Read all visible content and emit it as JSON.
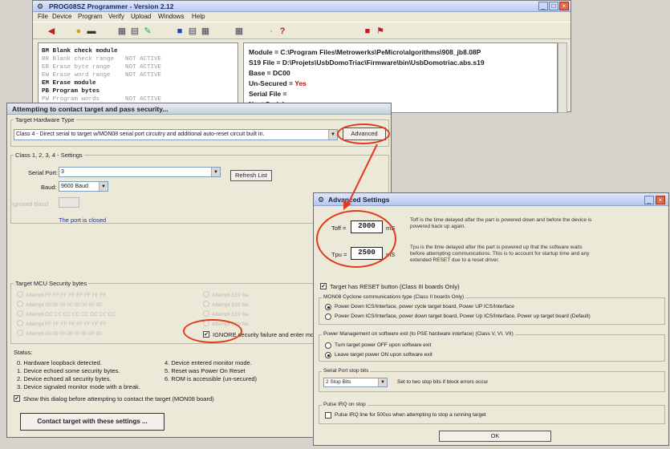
{
  "programmer": {
    "title": "PROG08SZ Programmer - Version 2.12",
    "menu": [
      "File",
      "Device",
      "Program",
      "Verify",
      "Upload",
      "Windows",
      "Help"
    ],
    "commands": [
      {
        "code": "BM",
        "label": "Blank check module",
        "active": true,
        "note": ""
      },
      {
        "code": "BR",
        "label": "Blank check range",
        "active": false,
        "note": "NOT ACTIVE"
      },
      {
        "code": "EB",
        "label": "Erase byte range",
        "active": false,
        "note": "NOT ACTIVE"
      },
      {
        "code": "EW",
        "label": "Erase word range",
        "active": false,
        "note": "NOT ACTIVE"
      },
      {
        "code": "EM",
        "label": "Erase module",
        "active": true,
        "note": ""
      },
      {
        "code": "PB",
        "label": "Program bytes",
        "active": true,
        "note": ""
      },
      {
        "code": "PW",
        "label": "Program words",
        "active": false,
        "note": "NOT ACTIVE"
      }
    ],
    "info": {
      "module": "Module = C:\\Program Files\\Metrowerks\\PeMicro\\algorithms\\908_jb8.08P",
      "s19": "S19 File = D:\\Projets\\UsbDomoTriac\\Firmware\\bin\\UsbDomotriac.abs.s19",
      "base": "Base = DC00",
      "unsecured_label": "Un-Secured = ",
      "unsecured_value": "Yes",
      "serial_file": "Serial File =",
      "next_serial": "Next Serial ="
    }
  },
  "attempt": {
    "title": "Attempting to contact target and pass security...",
    "hw_group": "Target Hardware Type",
    "hw_value": "Class 4 - Direct serial to target w/MON08 serial port circuitry and additional auto-reset circuit built in.",
    "advanced_btn": "Advanced",
    "settings_group": "Class 1, 2, 3, 4 - Settings",
    "serial_port_label": "Serial Port:",
    "serial_port_value": "3",
    "refresh_btn": "Refresh List",
    "baud_label": "Baud:",
    "baud_value": "9600 Baud",
    "ignored_label": "Ignored Baud",
    "port_status": "The port is closed",
    "security_group": "Target MCU Security bytes",
    "security_left": [
      "Attempt FF FF FF FF FF FF FF FF",
      "Attempt 00 00 00 00 00 00 00 00",
      "Attempt CC CC CC CC CC CC CC CC",
      "Attempt FF FF FF FF FF FF FF FF",
      "Attempt 00 00 00 00 00 00 00 00"
    ],
    "security_right": [
      "Attempt S19 file",
      "Attempt S19 file",
      "Attempt S19 file",
      "Attempt S19 file"
    ],
    "ignore_label": "IGNORE security failure and enter monitor",
    "status_header": "Status:",
    "status_left": [
      "0. Hardware loopback detected.",
      "1. Device echoed some security bytes.",
      "2. Device echoed all security bytes.",
      "3. Device signaled monitor mode with a break."
    ],
    "status_right": [
      "4. Device entered monitor mode.",
      "5. Reset was Power On Reset",
      "6. ROM is accessible (un-secured)"
    ],
    "show_dialog": "Show this dialog before attempting to contact the target (MON08 board)",
    "contact_btn": "Contact target with these settings ..."
  },
  "advanced": {
    "title": "Advanced Settings",
    "toff_label": "Toff =",
    "toff_value": "2000",
    "toff_unit": "mS",
    "toff_desc": "Toff is the time delayed after the part is powered down and before the device is powered back up again.",
    "ton_label": "Tpu =",
    "ton_value": "2500",
    "ton_unit": "mS",
    "ton_desc": "Tpu is the time delayed after the part is powered up that the software waits before attempting communications. This is to account for startup time and any extended RESET due to a reset driver.",
    "reset_label": "Target has RESET button (Class III boards Only)",
    "group1_title": "MON08 Cyclone communications type (Class II boards Only)",
    "group1_opt1": "Power Down ICS/Interface, power cycle target board, Power UP ICS/Interface",
    "group1_opt2": "Power Down ICS/Interface, power down target board, Power Up ICS/Interface, Power up target board (Default)",
    "group2_title": "Power Management on software exit (to PSE hardware interface) (Class V, VI, VII)",
    "group2_opt1": "Turn target power OFF upon software exit",
    "group2_opt2": "Leave target power ON upon software exit",
    "group3_title": "Serial Port stop bits",
    "stopbits_value": "2 Stop Bits",
    "stopbits_note": "Set to two stop bits if block errors occur",
    "group4_title": "Pulse IRQ on stop",
    "pulse_label": "Pulse IRQ line for 500us when attempting to stop a running target",
    "ok_btn": "OK"
  },
  "colors": {
    "annotation": "#e03a1a",
    "title_blue": "#b9cbf2"
  },
  "icons": [
    "arrow-left-icon",
    "bulb-icon",
    "minus-icon",
    "grid-icon",
    "save-icon",
    "question-icon",
    "close-icon"
  ]
}
